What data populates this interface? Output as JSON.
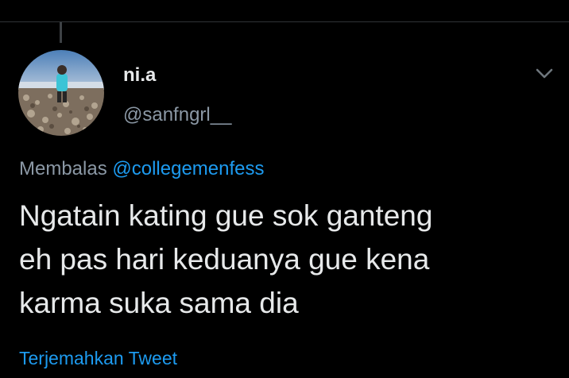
{
  "tweet": {
    "author": {
      "display_name": "ni.a",
      "handle": "@sanfngrl__"
    },
    "reply_to": {
      "prefix": "Membalas",
      "mention": "@collegemenfess"
    },
    "text_lines": [
      "Ngatain kating gue sok ganteng",
      "eh pas hari keduanya gue kena",
      "karma suka sama dia"
    ],
    "translate_label": "Terjemahkan Tweet"
  },
  "icons": {
    "menu": "chevron-down-icon"
  },
  "colors": {
    "background": "#000000",
    "link": "#1d9bf0",
    "secondary_text": "#8b98a5",
    "primary_text": "#e7e9ea"
  }
}
